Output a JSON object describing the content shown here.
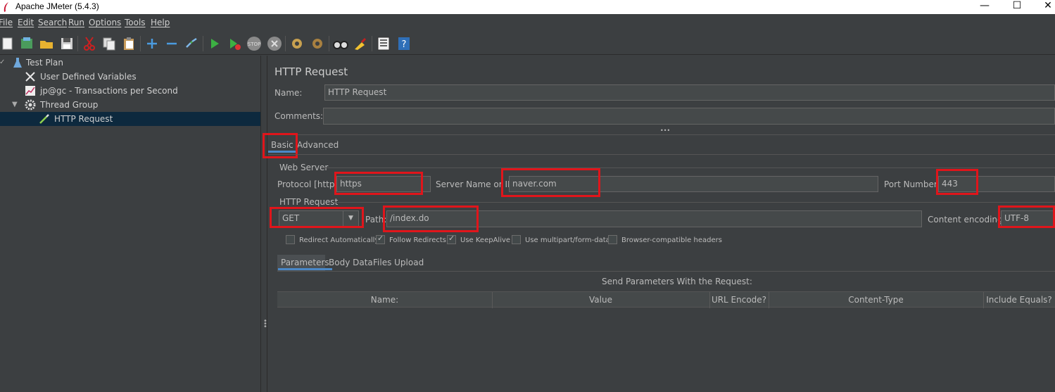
{
  "window": {
    "title": "Apache JMeter (5.4.3)",
    "minimize": "—",
    "maximize": "☐",
    "close": "✕"
  },
  "menu": [
    "File",
    "Edit",
    "Search",
    "Run",
    "Options",
    "Tools",
    "Help"
  ],
  "tree": {
    "items": [
      {
        "label": "Test Plan",
        "icon": "flask-icon"
      },
      {
        "label": "User Defined Variables",
        "icon": "wrench-icon"
      },
      {
        "label": "jp@gc - Transactions per Second",
        "icon": "graph-icon"
      },
      {
        "label": "Thread Group",
        "icon": "gear-icon"
      },
      {
        "label": "HTTP Request",
        "icon": "pipette-icon"
      }
    ],
    "selected_index": 4
  },
  "panel": {
    "title": "HTTP Request",
    "name_label": "Name:",
    "name_value": "HTTP Request",
    "comments_label": "Comments:",
    "comments_value": "",
    "collapse_dots": "•••",
    "tabs": [
      "Basic",
      "Advanced"
    ],
    "active_tab": "Basic"
  },
  "web_server": {
    "section_label": "Web Server",
    "protocol_label": "Protocol [http]:",
    "protocol_value": "https",
    "server_label": "Server Name or IP:",
    "server_value": "naver.com",
    "port_label": "Port Number:",
    "port_value": "443"
  },
  "http_request": {
    "section_label": "HTTP Request",
    "method_value": "GET",
    "path_label": "Path:",
    "path_value": "/index.do",
    "encoding_label": "Content encoding:",
    "encoding_value": "UTF-8",
    "options": [
      {
        "label": "Redirect Automatically",
        "checked": false
      },
      {
        "label": "Follow Redirects",
        "checked": true
      },
      {
        "label": "Use KeepAlive",
        "checked": true
      },
      {
        "label": "Use multipart/form-data",
        "checked": false
      },
      {
        "label": "Browser-compatible headers",
        "checked": false
      }
    ]
  },
  "params": {
    "tabs": [
      "Parameters",
      "Body Data",
      "Files Upload"
    ],
    "active_tab": "Parameters",
    "caption": "Send Parameters With the Request:",
    "columns": [
      "Name:",
      "Value",
      "URL Encode?",
      "Content-Type",
      "Include Equals?"
    ]
  },
  "colors": {
    "background": "#3c3f41",
    "field": "#45494a",
    "highlight": "#e0151b",
    "tab_accent": "#4a88c7",
    "tree_selected": "#0d293e"
  }
}
